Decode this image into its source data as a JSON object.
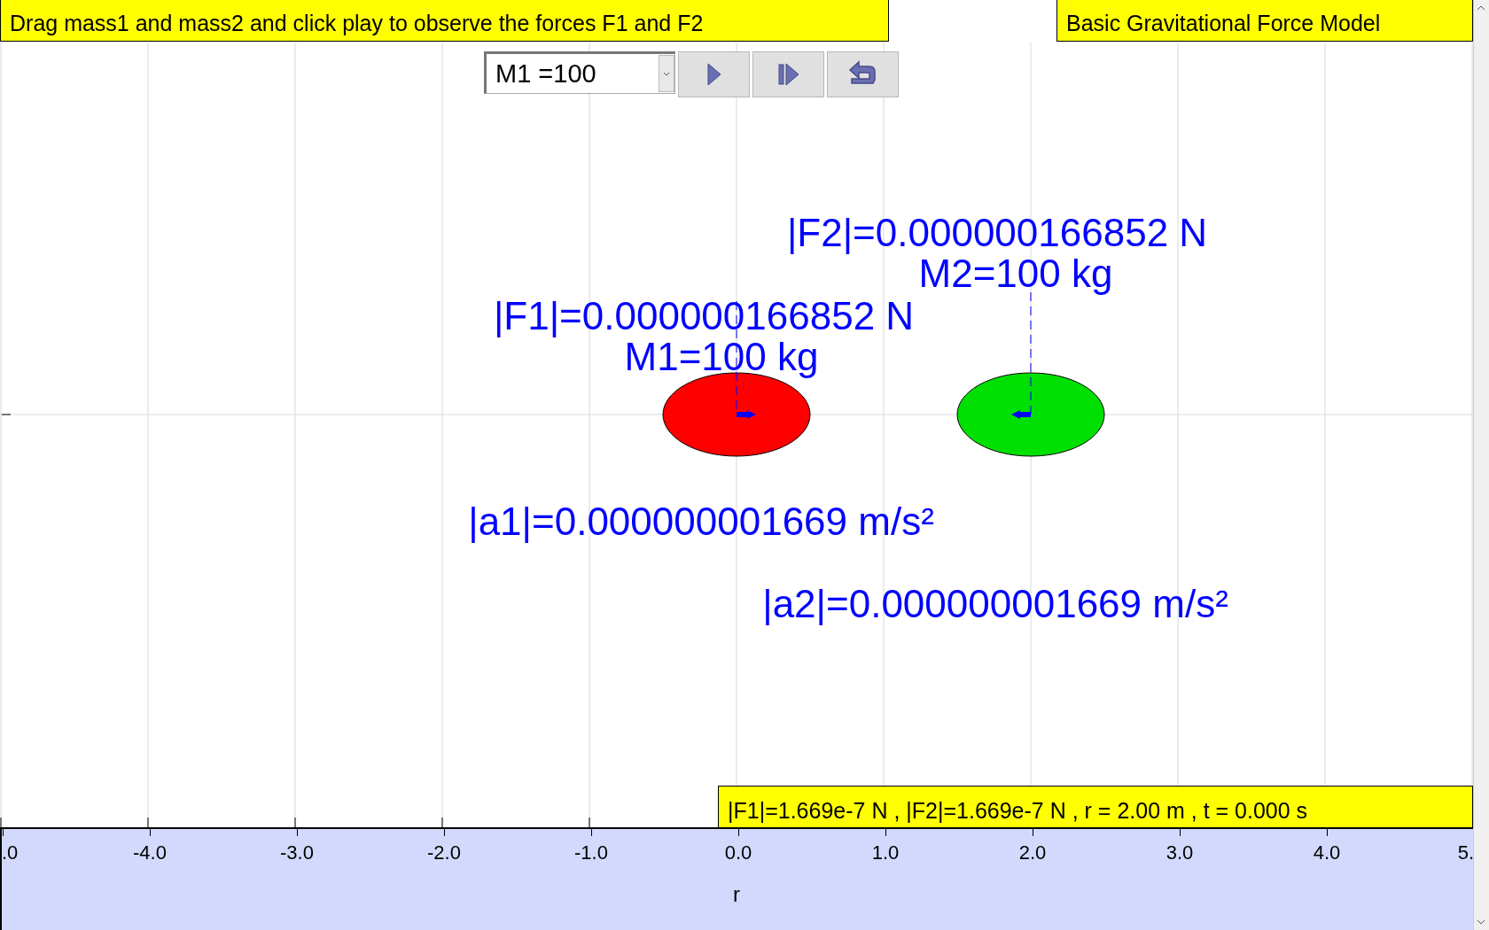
{
  "instruction": "Drag mass1 and mass2 and click play to observe the forces F1 and F2",
  "model_title": "Basic Gravitational Force Model",
  "mass_select": {
    "value": "M1 =100"
  },
  "buttons": [
    {
      "kind": "play"
    },
    {
      "kind": "step"
    },
    {
      "kind": "reset"
    }
  ],
  "masses": [
    {
      "force": "|F1|=0.000000166852 N",
      "mass": "M1=100 kg",
      "acceleration": "|a1|=0.000000001669 m/s²",
      "color": "#ff0000"
    },
    {
      "force": "|F2|=0.000000166852 N",
      "mass": "M2=100 kg",
      "acceleration": "|a2|=0.000000001669 m/s²",
      "color": "#00e000"
    }
  ],
  "status": "|F1|=1.669e-7 N , |F2|=1.669e-7 N , r = 2.00 m , t = 0.000 s",
  "axis": {
    "label": "r",
    "ticks": [
      ".0",
      "-4.0",
      "-3.0",
      "-2.0",
      "-1.0",
      "0.0",
      "1.0",
      "2.0",
      "3.0",
      "4.0",
      "5."
    ]
  }
}
